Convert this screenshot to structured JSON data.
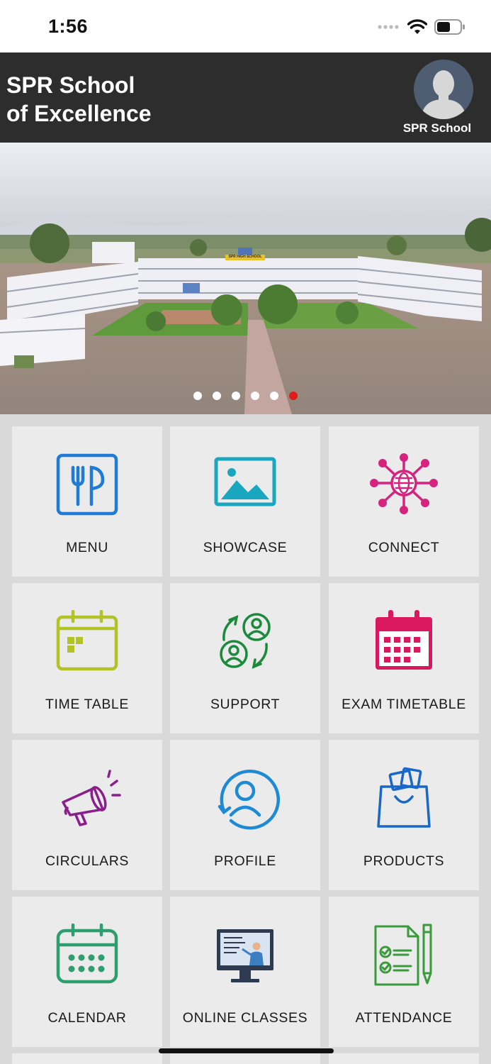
{
  "status_bar": {
    "time": "1:56"
  },
  "header": {
    "title": "SPR School\nof Excellence",
    "profile_name": "SPR School"
  },
  "banner": {
    "sign_text": "SPR HIGH SCHOOL",
    "slide_count": 6,
    "active_slide": 6
  },
  "tiles": [
    {
      "label": "MENU",
      "icon": "cutlery-icon",
      "color": "#1f7bd6"
    },
    {
      "label": "SHOWCASE",
      "icon": "image-icon",
      "color": "#19a7bf"
    },
    {
      "label": "CONNECT",
      "icon": "network-globe-icon",
      "color": "#d5237e"
    },
    {
      "label": "TIME TABLE",
      "icon": "timetable-calendar-icon",
      "color": "#b3c326"
    },
    {
      "label": "SUPPORT",
      "icon": "support-users-icon",
      "color": "#1c8a3d"
    },
    {
      "label": "EXAM TIMETABLE",
      "icon": "exam-calendar-icon",
      "color": "#d9185f"
    },
    {
      "label": "CIRCULARS",
      "icon": "megaphone-icon",
      "color": "#8a1e8c"
    },
    {
      "label": "PROFILE",
      "icon": "user-circle-icon",
      "color": "#1e8ad6"
    },
    {
      "label": "PRODUCTS",
      "icon": "shopping-bag-icon",
      "color": "#1967c9"
    },
    {
      "label": "CALENDAR",
      "icon": "calendar-icon",
      "color": "#2f9e6e"
    },
    {
      "label": "ONLINE CLASSES",
      "icon": "online-class-icon",
      "color": "#2d3a4f"
    },
    {
      "label": "ATTENDANCE",
      "icon": "attendance-checklist-icon",
      "color": "#3a9a3c"
    }
  ]
}
